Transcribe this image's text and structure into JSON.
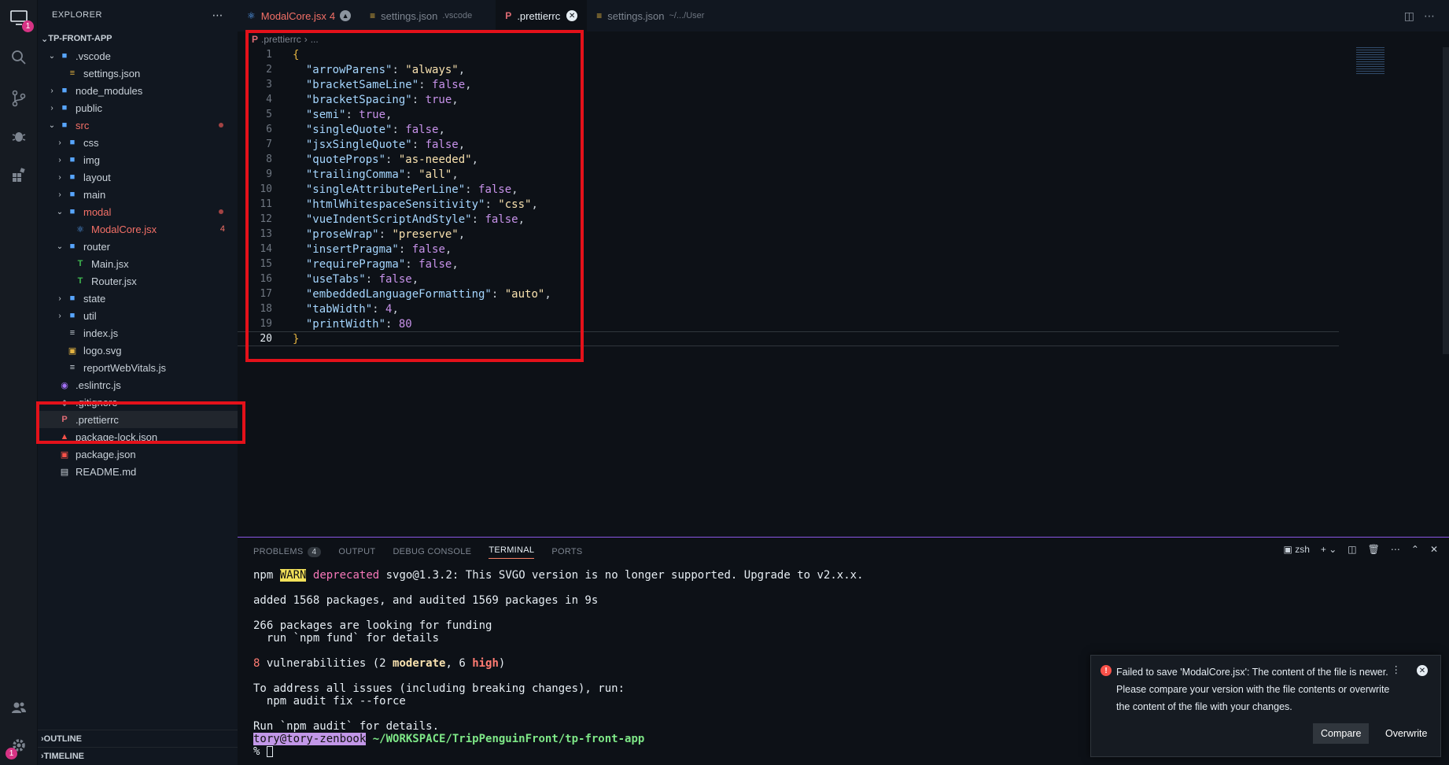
{
  "activity_bar": {
    "items": [
      "explorer",
      "search",
      "source-control",
      "run-debug",
      "extensions"
    ],
    "explorer_badge": "1",
    "settings_badge": "1"
  },
  "explorer": {
    "title": "EXPLORER",
    "more": "⋯",
    "project": "TP-FRONT-APP",
    "tree": [
      {
        "name": ".vscode",
        "depth": 1,
        "type": "folder",
        "open": true
      },
      {
        "name": "settings.json",
        "depth": 2,
        "type": "json"
      },
      {
        "name": "node_modules",
        "depth": 1,
        "type": "folder"
      },
      {
        "name": "public",
        "depth": 1,
        "type": "folder"
      },
      {
        "name": "src",
        "depth": 1,
        "type": "folder",
        "open": true,
        "error": true
      },
      {
        "name": "css",
        "depth": 2,
        "type": "folder"
      },
      {
        "name": "img",
        "depth": 2,
        "type": "folder"
      },
      {
        "name": "layout",
        "depth": 2,
        "type": "folder"
      },
      {
        "name": "main",
        "depth": 2,
        "type": "folder"
      },
      {
        "name": "modal",
        "depth": 2,
        "type": "folder",
        "open": true,
        "error": true
      },
      {
        "name": "ModalCore.jsx",
        "depth": 3,
        "type": "react",
        "error": true,
        "count": "4"
      },
      {
        "name": "router",
        "depth": 2,
        "type": "folder",
        "open": true
      },
      {
        "name": "Main.jsx",
        "depth": 3,
        "type": "jsx"
      },
      {
        "name": "Router.jsx",
        "depth": 3,
        "type": "jsx"
      },
      {
        "name": "state",
        "depth": 2,
        "type": "folder"
      },
      {
        "name": "util",
        "depth": 2,
        "type": "folder"
      },
      {
        "name": "index.js",
        "depth": 2,
        "type": "js"
      },
      {
        "name": "logo.svg",
        "depth": 2,
        "type": "svg"
      },
      {
        "name": "reportWebVitals.js",
        "depth": 2,
        "type": "js"
      },
      {
        "name": ".eslintrc.js",
        "depth": 1,
        "type": "eslint"
      },
      {
        "name": ".gitignore",
        "depth": 1,
        "type": "git"
      },
      {
        "name": ".prettierrc",
        "depth": 1,
        "type": "prettier",
        "selected": true
      },
      {
        "name": "package-lock.json",
        "depth": 1,
        "type": "lock"
      },
      {
        "name": "package.json",
        "depth": 1,
        "type": "npm"
      },
      {
        "name": "README.md",
        "depth": 1,
        "type": "md"
      }
    ],
    "outline": "OUTLINE",
    "timeline": "TIMELINE"
  },
  "tabs": [
    {
      "label": "ModalCore.jsx",
      "suffix": "4",
      "sub": "",
      "state": "error"
    },
    {
      "label": "settings.json",
      "suffix": "",
      "sub": ".vscode",
      "state": "normal"
    },
    {
      "label": ".prettierrc",
      "suffix": "",
      "sub": "",
      "state": "active"
    },
    {
      "label": "settings.json",
      "suffix": "",
      "sub": "~/.../User",
      "state": "normal"
    }
  ],
  "breadcrumb": {
    "file": ".prettierrc",
    "rest": "..."
  },
  "editor": {
    "lines": [
      {
        "n": "1",
        "key": "",
        "val": "",
        "kind": "open"
      },
      {
        "n": "2",
        "key": "\"arrowParens\"",
        "val": "\"always\"",
        "kind": "s",
        "comma": ","
      },
      {
        "n": "3",
        "key": "\"bracketSameLine\"",
        "val": "false",
        "kind": "b",
        "comma": ","
      },
      {
        "n": "4",
        "key": "\"bracketSpacing\"",
        "val": "true",
        "kind": "b",
        "comma": ","
      },
      {
        "n": "5",
        "key": "\"semi\"",
        "val": "true",
        "kind": "b",
        "comma": ","
      },
      {
        "n": "6",
        "key": "\"singleQuote\"",
        "val": "false",
        "kind": "b",
        "comma": ","
      },
      {
        "n": "7",
        "key": "\"jsxSingleQuote\"",
        "val": "false",
        "kind": "b",
        "comma": ","
      },
      {
        "n": "8",
        "key": "\"quoteProps\"",
        "val": "\"as-needed\"",
        "kind": "s",
        "comma": ","
      },
      {
        "n": "9",
        "key": "\"trailingComma\"",
        "val": "\"all\"",
        "kind": "s",
        "comma": ","
      },
      {
        "n": "10",
        "key": "\"singleAttributePerLine\"",
        "val": "false",
        "kind": "b",
        "comma": ","
      },
      {
        "n": "11",
        "key": "\"htmlWhitespaceSensitivity\"",
        "val": "\"css\"",
        "kind": "s",
        "comma": ","
      },
      {
        "n": "12",
        "key": "\"vueIndentScriptAndStyle\"",
        "val": "false",
        "kind": "b",
        "comma": ","
      },
      {
        "n": "13",
        "key": "\"proseWrap\"",
        "val": "\"preserve\"",
        "kind": "s",
        "comma": ","
      },
      {
        "n": "14",
        "key": "\"insertPragma\"",
        "val": "false",
        "kind": "b",
        "comma": ","
      },
      {
        "n": "15",
        "key": "\"requirePragma\"",
        "val": "false",
        "kind": "b",
        "comma": ","
      },
      {
        "n": "16",
        "key": "\"useTabs\"",
        "val": "false",
        "kind": "b",
        "comma": ","
      },
      {
        "n": "17",
        "key": "\"embeddedLanguageFormatting\"",
        "val": "\"auto\"",
        "kind": "s",
        "comma": ","
      },
      {
        "n": "18",
        "key": "\"tabWidth\"",
        "val": "4",
        "kind": "n",
        "comma": ","
      },
      {
        "n": "19",
        "key": "\"printWidth\"",
        "val": "80",
        "kind": "n",
        "comma": ""
      },
      {
        "n": "20",
        "key": "",
        "val": "",
        "kind": "close"
      }
    ]
  },
  "panel": {
    "tabs": [
      "PROBLEMS",
      "OUTPUT",
      "DEBUG CONSOLE",
      "TERMINAL",
      "PORTS"
    ],
    "problems_count": "4",
    "active_tab": "TERMINAL",
    "shell": "zsh",
    "terminal": {
      "npm": "npm",
      "warn": "WARN",
      "deprecated": "deprecated",
      "warn_msg": "svgo@1.3.2: This SVGO version is no longer supported. Upgrade to v2.x.x.",
      "added": "added 1568 packages, and audited 1569 packages in 9s",
      "funding1": "266 packages are looking for funding",
      "funding2": "  run `npm fund` for details",
      "vuln_count": "8",
      "vuln_text": "vulnerabilities (2",
      "moderate": "moderate",
      "comma6": ", 6",
      "high": "high",
      "close_paren": ")",
      "address1": "To address all issues (including breaking changes), run:",
      "address2": "  npm audit fix --force",
      "audit": "Run `npm audit` for details.",
      "user": "tory@tory-zenbook",
      "path": "~/WORKSPACE/TripPenguinFront/tp-front-app",
      "prompt": "%"
    }
  },
  "notification": {
    "message": "Failed to save 'ModalCore.jsx': The content of the file is newer. Please compare your version with the file contents or overwrite the content of the file with your changes.",
    "compare_label": "Compare",
    "overwrite_label": "Overwrite"
  }
}
